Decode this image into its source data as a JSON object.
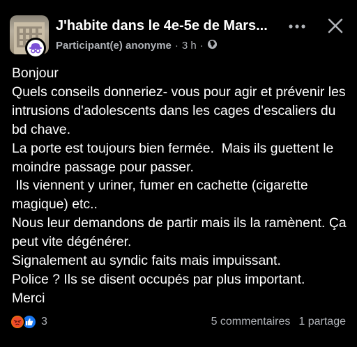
{
  "header": {
    "group_title": "J'habite dans le 4e-5e de Mars...",
    "author": "Participant(e) anonyme",
    "separator": "·",
    "time": "3 h",
    "separator2": "·",
    "privacy_icon": "globe-icon",
    "more_icon": "more-horiz-icon",
    "close_icon": "close-icon",
    "badge_icon": "anonymous-incognito-icon"
  },
  "post": {
    "text": "Bonjour\nQuels conseils donneriez- vous pour agir et prévenir les intrusions d'adolescents dans les cages d'escaliers du bd chave.\nLa porte est toujours bien fermée.  Mais ils guettent le moindre passage pour passer.\n Ils viennent y uriner, fumer en cachette (cigarette magique) etc..\nNous leur demandons de partir mais ils la ramènent. Ça peut vite dégénérer.\nSignalement au syndic faits mais impuissant.\nPolice ? Ils se disent occupés par plus important.\nMerci"
  },
  "footer": {
    "reaction_icons": [
      "angry-reaction-icon",
      "like-reaction-icon"
    ],
    "reaction_count": "3",
    "comments": "5 commentaires",
    "shares": "1 partage"
  },
  "colors": {
    "background": "#000000",
    "text": "#ffffff",
    "secondary_text": "#b0b3b8",
    "like_blue": "#1877f2",
    "angry_orange": "#e9710f"
  }
}
